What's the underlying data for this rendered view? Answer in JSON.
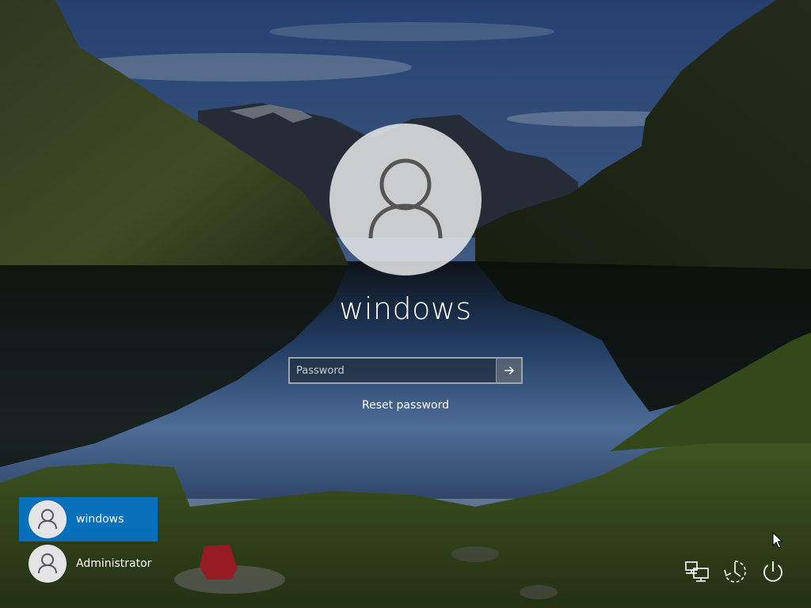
{
  "login": {
    "username": "windows",
    "password_placeholder": "Password",
    "reset_password_label": "Reset password"
  },
  "users": [
    {
      "name": "windows",
      "selected": true
    },
    {
      "name": "Administrator",
      "selected": false
    }
  ],
  "system_icons": [
    "network-icon",
    "accessibility-icon",
    "power-icon"
  ],
  "colors": {
    "selected_tile": "#0078d7",
    "avatar_bg": "#e6e6e8",
    "avatar_glyph": "#555555"
  }
}
